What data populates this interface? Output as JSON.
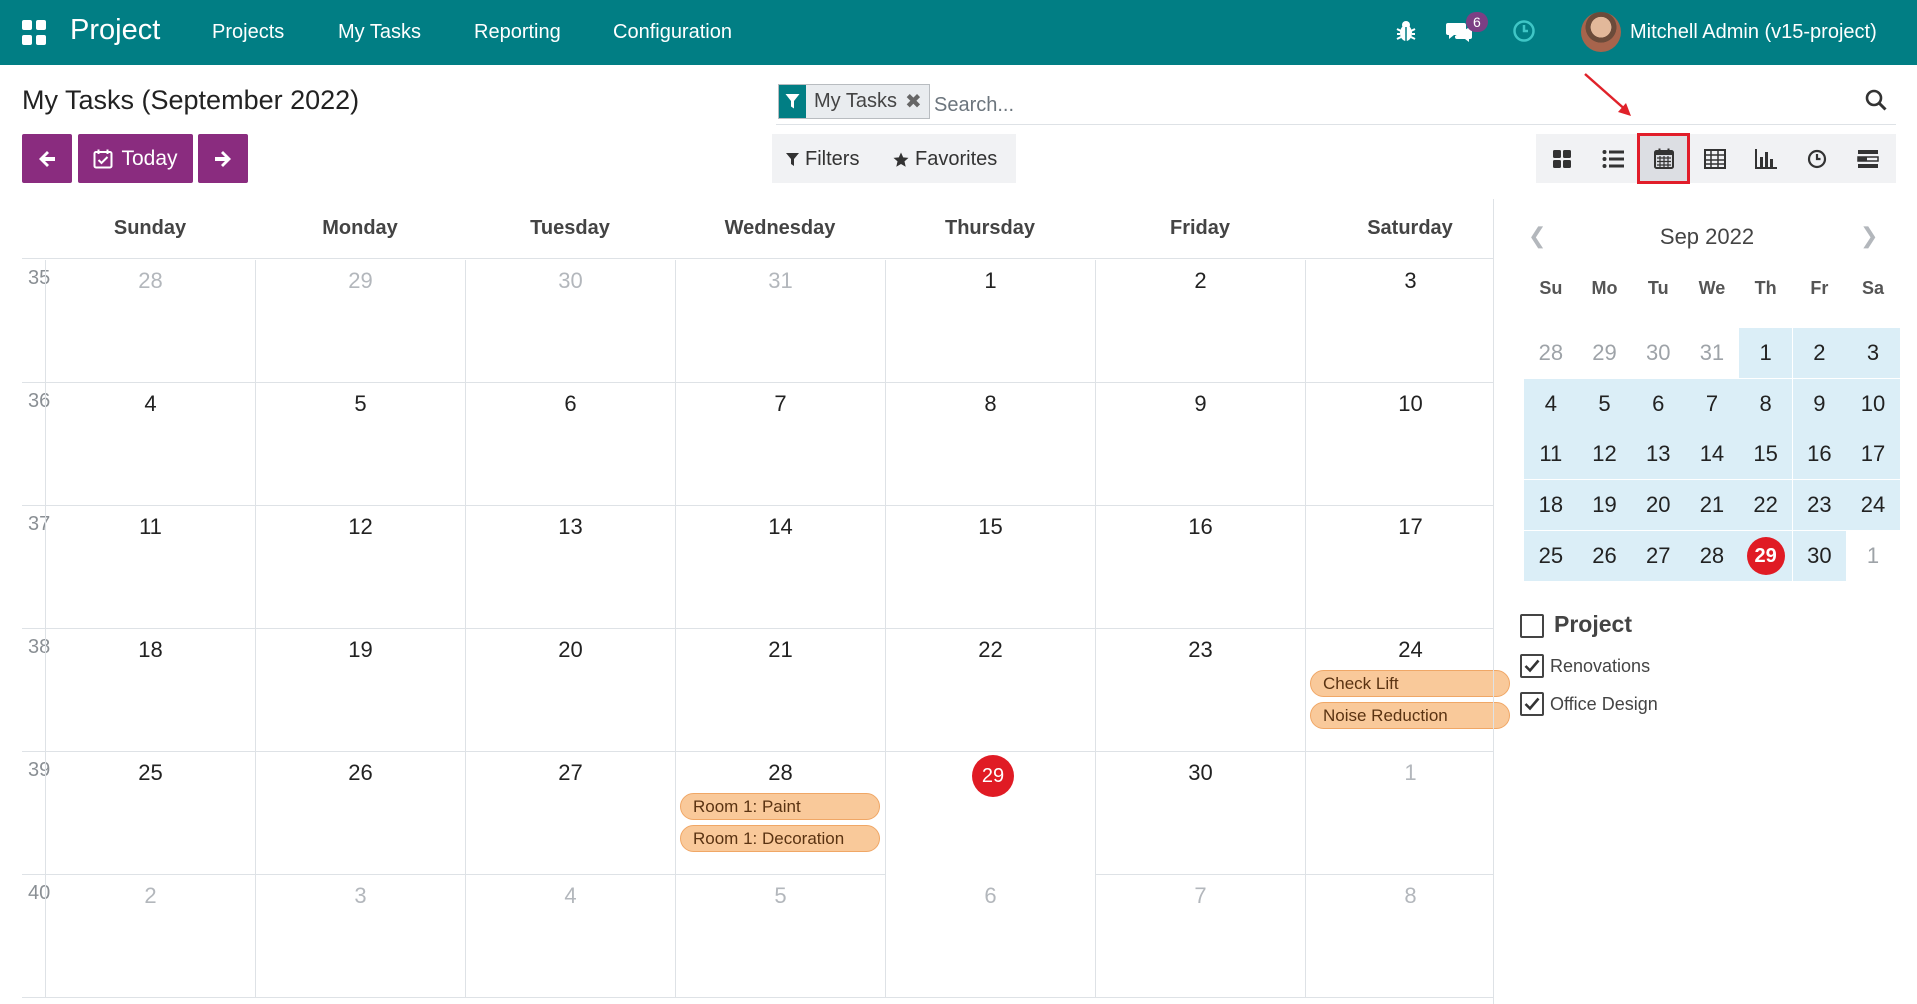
{
  "navbar": {
    "brand": "Project",
    "menu": [
      "Projects",
      "My Tasks",
      "Reporting",
      "Configuration"
    ],
    "message_count": "6",
    "user": "Mitchell Admin (v15-project)"
  },
  "control": {
    "title": "My Tasks (September 2022)",
    "today_label": "Today",
    "facet_label": "My Tasks",
    "search_placeholder": "Search...",
    "filters_label": "Filters",
    "favorites_label": "Favorites",
    "views": [
      "kanban-icon",
      "list-icon",
      "calendar-icon",
      "pivot-icon",
      "graph-icon",
      "activity-icon",
      "gantt-icon"
    ],
    "active_view": "calendar-icon"
  },
  "calendar": {
    "weekdays": [
      "Sunday",
      "Monday",
      "Tuesday",
      "Wednesday",
      "Thursday",
      "Friday",
      "Saturday"
    ],
    "weeks": [
      {
        "number": "35",
        "days": [
          "28",
          "29",
          "30",
          "31",
          "1",
          "2",
          "3"
        ],
        "muted": [
          true,
          true,
          true,
          true,
          false,
          false,
          false
        ]
      },
      {
        "number": "36",
        "days": [
          "4",
          "5",
          "6",
          "7",
          "8",
          "9",
          "10"
        ],
        "muted": [
          false,
          false,
          false,
          false,
          false,
          false,
          false
        ]
      },
      {
        "number": "37",
        "days": [
          "11",
          "12",
          "13",
          "14",
          "15",
          "16",
          "17"
        ],
        "muted": [
          false,
          false,
          false,
          false,
          false,
          false,
          false
        ]
      },
      {
        "number": "38",
        "days": [
          "18",
          "19",
          "20",
          "21",
          "22",
          "23",
          "24"
        ],
        "muted": [
          false,
          false,
          false,
          false,
          false,
          false,
          false
        ]
      },
      {
        "number": "39",
        "days": [
          "25",
          "26",
          "27",
          "28",
          "29",
          "30",
          "1"
        ],
        "muted": [
          false,
          false,
          false,
          false,
          false,
          false,
          true
        ]
      },
      {
        "number": "40",
        "days": [
          "2",
          "3",
          "4",
          "5",
          "6",
          "7",
          "8"
        ],
        "muted": [
          true,
          true,
          true,
          true,
          true,
          true,
          true
        ]
      }
    ],
    "today": {
      "week": 4,
      "day": 4
    },
    "events": [
      {
        "week": 3,
        "day": 6,
        "title": "Check Lift"
      },
      {
        "week": 3,
        "day": 6,
        "title": "Noise Reduction"
      },
      {
        "week": 4,
        "day": 3,
        "title": "Room 1: Paint"
      },
      {
        "week": 4,
        "day": 3,
        "title": "Room 1: Decoration"
      }
    ],
    "event_color": "#f9c99a"
  },
  "mini_calendar": {
    "month": "Sep 2022",
    "weekdays": [
      "Su",
      "Mo",
      "Tu",
      "We",
      "Th",
      "Fr",
      "Sa"
    ],
    "weeks": [
      [
        "28",
        "29",
        "30",
        "31",
        "1",
        "2",
        "3"
      ],
      [
        "4",
        "5",
        "6",
        "7",
        "8",
        "9",
        "10"
      ],
      [
        "11",
        "12",
        "13",
        "14",
        "15",
        "16",
        "17"
      ],
      [
        "18",
        "19",
        "20",
        "21",
        "22",
        "23",
        "24"
      ],
      [
        "25",
        "26",
        "27",
        "28",
        "29",
        "30",
        "1"
      ]
    ]
  },
  "filter_panel": {
    "title": "Project",
    "items": [
      {
        "label": "Renovations",
        "checked": true
      },
      {
        "label": "Office Design",
        "checked": true
      }
    ]
  }
}
